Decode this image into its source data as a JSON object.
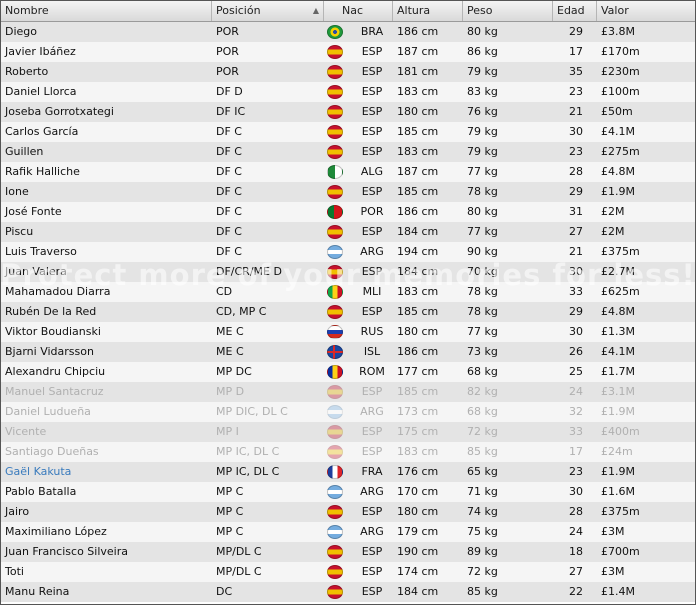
{
  "columns": {
    "nombre": "Nombre",
    "posicion": "Posición",
    "nac": "Nac",
    "altura": "Altura",
    "peso": "Peso",
    "edad": "Edad",
    "valor": "Valor"
  },
  "flag_colors": {
    "BRA": "radial-gradient(circle at 50% 50%, #2c4fa3 0 22%, #f5d000 23% 48%, #1f9a3d 49%)",
    "ESP": "linear-gradient(#c8102e 0 28%, #f1bf00 28% 72%, #c8102e 72%)",
    "ALG": "linear-gradient(90deg, #1f8a3a 0 50%, #ffffff 50%)",
    "POR": "linear-gradient(90deg, #0a7a2f 0 42%, #d5151b 42%)",
    "ARG": "linear-gradient(#74acdf 0 33%, #ffffff 33% 67%, #74acdf 67%)",
    "MLI": "linear-gradient(90deg, #14a84a 0 33%, #fcd116 33% 67%, #ce1126 67%)",
    "RUS": "linear-gradient(#ffffff 0 33%, #1c3fb0 33% 67%, #d52b1e 67%)",
    "ISL": "linear-gradient(90deg, transparent 0 35%, #d72828 35% 50%, transparent 50%), linear-gradient(transparent 0 42%, #d72828 42% 58%, transparent 58%), #1a47a0",
    "ROM": "linear-gradient(90deg, #0b2fa0 0 33%, #fcd116 33% 67%, #ce1126 67%)",
    "FRA": "linear-gradient(90deg, #1f3e9e 0 33%, #ffffff 33% 67%, #e1242b 67%)"
  },
  "flag_icons": {
    "BRA": "brazil-flag-icon",
    "ESP": "spain-flag-icon",
    "ALG": "algeria-flag-icon",
    "POR": "portugal-flag-icon",
    "ARG": "argentina-flag-icon",
    "MLI": "mali-flag-icon",
    "RUS": "russia-flag-icon",
    "ISL": "iceland-flag-icon",
    "ROM": "romania-flag-icon",
    "FRA": "france-flag-icon"
  },
  "watermark": "Protect more of your memories for less!",
  "players": [
    {
      "name": "Diego",
      "pos": "POR",
      "nac": "BRA",
      "alt": "186 cm",
      "peso": "80 kg",
      "edad": "29",
      "val": "£3.8M",
      "state": "normal"
    },
    {
      "name": "Javier Ibáñez",
      "pos": "POR",
      "nac": "ESP",
      "alt": "187 cm",
      "peso": "86 kg",
      "edad": "17",
      "val": "£170m",
      "state": "normal"
    },
    {
      "name": "Roberto",
      "pos": "POR",
      "nac": "ESP",
      "alt": "181 cm",
      "peso": "79 kg",
      "edad": "35",
      "val": "£230m",
      "state": "normal"
    },
    {
      "name": "Daniel Llorca",
      "pos": "DF D",
      "nac": "ESP",
      "alt": "183 cm",
      "peso": "83 kg",
      "edad": "23",
      "val": "£100m",
      "state": "normal"
    },
    {
      "name": "Joseba Gorrotxategi",
      "pos": "DF IC",
      "nac": "ESP",
      "alt": "180 cm",
      "peso": "76 kg",
      "edad": "21",
      "val": "£50m",
      "state": "normal"
    },
    {
      "name": "Carlos García",
      "pos": "DF C",
      "nac": "ESP",
      "alt": "185 cm",
      "peso": "79 kg",
      "edad": "30",
      "val": "£4.1M",
      "state": "normal"
    },
    {
      "name": "Guillen",
      "pos": "DF C",
      "nac": "ESP",
      "alt": "183 cm",
      "peso": "79 kg",
      "edad": "23",
      "val": "£275m",
      "state": "normal"
    },
    {
      "name": "Rafik Halliche",
      "pos": "DF C",
      "nac": "ALG",
      "alt": "187 cm",
      "peso": "77 kg",
      "edad": "28",
      "val": "£4.8M",
      "state": "normal"
    },
    {
      "name": "Ione",
      "pos": "DF C",
      "nac": "ESP",
      "alt": "185 cm",
      "peso": "78 kg",
      "edad": "29",
      "val": "£1.9M",
      "state": "normal"
    },
    {
      "name": "José Fonte",
      "pos": "DF C",
      "nac": "POR",
      "alt": "186 cm",
      "peso": "80 kg",
      "edad": "31",
      "val": "£2M",
      "state": "normal"
    },
    {
      "name": "Piscu",
      "pos": "DF C",
      "nac": "ESP",
      "alt": "184 cm",
      "peso": "77 kg",
      "edad": "27",
      "val": "£2M",
      "state": "normal"
    },
    {
      "name": "Luis Traverso",
      "pos": "DF C",
      "nac": "ARG",
      "alt": "194 cm",
      "peso": "90 kg",
      "edad": "21",
      "val": "£375m",
      "state": "normal"
    },
    {
      "name": "Juan Valera",
      "pos": "DF/CR/ME D",
      "nac": "ESP",
      "alt": "184 cm",
      "peso": "70 kg",
      "edad": "30",
      "val": "£2.7M",
      "state": "normal"
    },
    {
      "name": "Mahamadou Diarra",
      "pos": "CD",
      "nac": "MLI",
      "alt": "183 cm",
      "peso": "78 kg",
      "edad": "33",
      "val": "£625m",
      "state": "normal"
    },
    {
      "name": "Rubén De la Red",
      "pos": "CD, MP C",
      "nac": "ESP",
      "alt": "185 cm",
      "peso": "78 kg",
      "edad": "29",
      "val": "£4.8M",
      "state": "normal"
    },
    {
      "name": "Viktor Boudianski",
      "pos": "ME C",
      "nac": "RUS",
      "alt": "180 cm",
      "peso": "77 kg",
      "edad": "30",
      "val": "£1.3M",
      "state": "normal"
    },
    {
      "name": "Bjarni Vidarsson",
      "pos": "ME C",
      "nac": "ISL",
      "alt": "186 cm",
      "peso": "73 kg",
      "edad": "26",
      "val": "£4.1M",
      "state": "normal"
    },
    {
      "name": "Alexandru Chipciu",
      "pos": "MP DC",
      "nac": "ROM",
      "alt": "177 cm",
      "peso": "68 kg",
      "edad": "25",
      "val": "£1.7M",
      "state": "normal"
    },
    {
      "name": "Manuel Santacruz",
      "pos": "MP D",
      "nac": "ESP",
      "alt": "185 cm",
      "peso": "82 kg",
      "edad": "24",
      "val": "£3.1M",
      "state": "dim"
    },
    {
      "name": "Daniel Ludueña",
      "pos": "MP DIC, DL C",
      "nac": "ARG",
      "alt": "173 cm",
      "peso": "68 kg",
      "edad": "32",
      "val": "£1.9M",
      "state": "dim"
    },
    {
      "name": "Vicente",
      "pos": "MP I",
      "nac": "ESP",
      "alt": "175 cm",
      "peso": "72 kg",
      "edad": "33",
      "val": "£400m",
      "state": "dim"
    },
    {
      "name": "Santiago Dueñas",
      "pos": "MP IC, DL C",
      "nac": "ESP",
      "alt": "183 cm",
      "peso": "85 kg",
      "edad": "17",
      "val": "£24m",
      "state": "dim"
    },
    {
      "name": "Gaël Kakuta",
      "pos": "MP IC, DL C",
      "nac": "FRA",
      "alt": "176 cm",
      "peso": "65 kg",
      "edad": "23",
      "val": "£1.9M",
      "state": "link"
    },
    {
      "name": "Pablo Batalla",
      "pos": "MP C",
      "nac": "ARG",
      "alt": "170 cm",
      "peso": "71 kg",
      "edad": "30",
      "val": "£1.6M",
      "state": "normal"
    },
    {
      "name": "Jairo",
      "pos": "MP C",
      "nac": "ESP",
      "alt": "180 cm",
      "peso": "74 kg",
      "edad": "28",
      "val": "£375m",
      "state": "normal"
    },
    {
      "name": "Maximiliano López",
      "pos": "MP C",
      "nac": "ARG",
      "alt": "179 cm",
      "peso": "75 kg",
      "edad": "24",
      "val": "£3M",
      "state": "normal"
    },
    {
      "name": "Juan Francisco Silveira",
      "pos": "MP/DL C",
      "nac": "ESP",
      "alt": "190 cm",
      "peso": "89 kg",
      "edad": "18",
      "val": "£700m",
      "state": "normal"
    },
    {
      "name": "Toti",
      "pos": "MP/DL C",
      "nac": "ESP",
      "alt": "174 cm",
      "peso": "72 kg",
      "edad": "27",
      "val": "£3M",
      "state": "normal"
    },
    {
      "name": "Manu Reina",
      "pos": "DC",
      "nac": "ESP",
      "alt": "184 cm",
      "peso": "85 kg",
      "edad": "22",
      "val": "£1.4M",
      "state": "normal"
    }
  ]
}
